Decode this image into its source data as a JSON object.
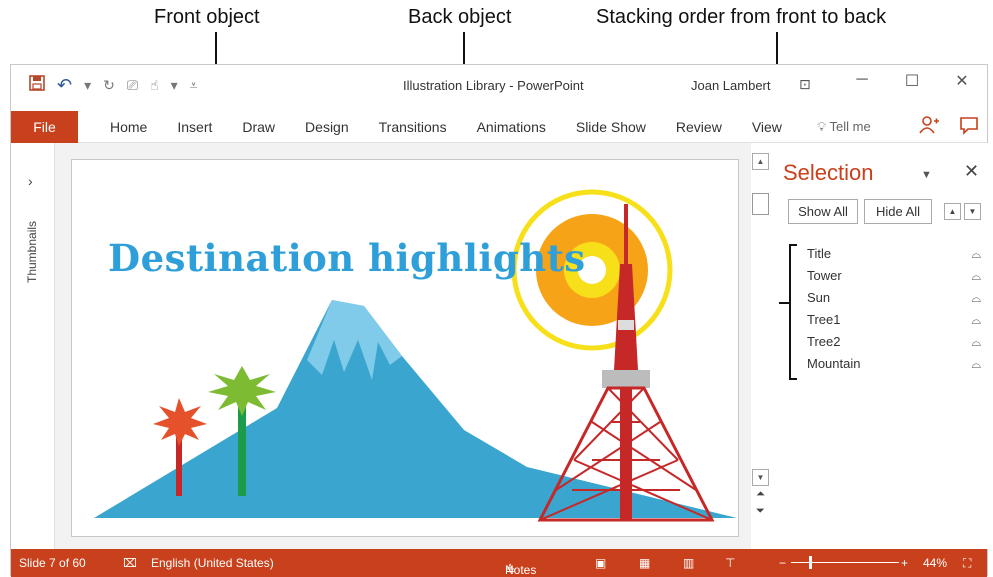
{
  "callouts": {
    "front": "Front object",
    "back": "Back object",
    "order": "Stacking order from front to back"
  },
  "window": {
    "title": "Illustration Library - PowerPoint",
    "user": "Joan Lambert",
    "controls": [
      "─",
      "☐",
      "✕"
    ]
  },
  "qat": {
    "save_icon": "save-icon",
    "undo": "↶",
    "redo": "↻"
  },
  "ribbon": {
    "file": "File",
    "tabs": [
      "Home",
      "Insert",
      "Draw",
      "Design",
      "Transitions",
      "Animations",
      "Slide Show",
      "Review",
      "View"
    ],
    "tell_me": "Tell me",
    "share_icon": "person-add-icon",
    "comment_icon": "comment-icon"
  },
  "left_pane": {
    "label": "Thumbnails"
  },
  "slide": {
    "title": "Destination highlights",
    "colors": {
      "title": "#2e9fd8",
      "mountain": "#3aa5cf",
      "sun": "#f6a318",
      "tower": "#c62828"
    }
  },
  "selection_pane": {
    "title": "Selection",
    "show_all": "Show All",
    "hide_all": "Hide All",
    "items": [
      "Title",
      "Tower",
      "Sun",
      "Tree1",
      "Tree2",
      "Mountain"
    ]
  },
  "statusbar": {
    "slide": "Slide 7 of 60",
    "language": "English (United States)",
    "notes": "Notes",
    "zoom": "44%"
  }
}
